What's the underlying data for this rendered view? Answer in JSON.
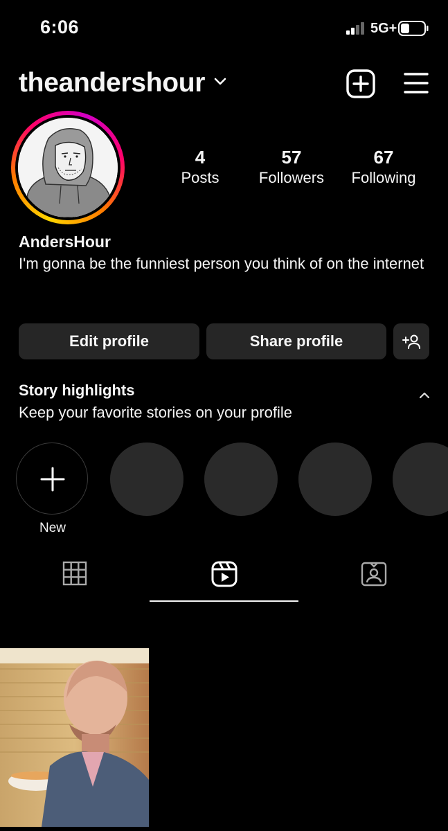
{
  "status_bar": {
    "time": "6:06",
    "network": "5G+"
  },
  "header": {
    "username": "theandershour",
    "icons": [
      "chevron-down-icon",
      "plus-square-icon",
      "hamburger-menu-icon"
    ]
  },
  "profile": {
    "stats": [
      {
        "number": "4",
        "label": "Posts"
      },
      {
        "number": "57",
        "label": "Followers"
      },
      {
        "number": "67",
        "label": "Following"
      }
    ],
    "display_name": "AndersHour",
    "bio": "I'm gonna be the funniest person you think of on the internet"
  },
  "actions": {
    "edit_label": "Edit profile",
    "share_label": "Share profile",
    "suggest_icon": "add-person-icon"
  },
  "highlights": {
    "title": "Story highlights",
    "subtitle": "Keep your favorite stories on your profile",
    "new_label": "New"
  },
  "tabs": [
    {
      "icon": "grid-icon",
      "active": false
    },
    {
      "icon": "reels-icon",
      "active": true
    },
    {
      "icon": "tagged-icon",
      "active": false
    }
  ],
  "colors": {
    "background": "#000000",
    "surface": "#262626",
    "text": "#f5f5f5",
    "ring_gradient": [
      "#ffd600",
      "#ff7a00",
      "#ff0169",
      "#d300c5"
    ]
  }
}
